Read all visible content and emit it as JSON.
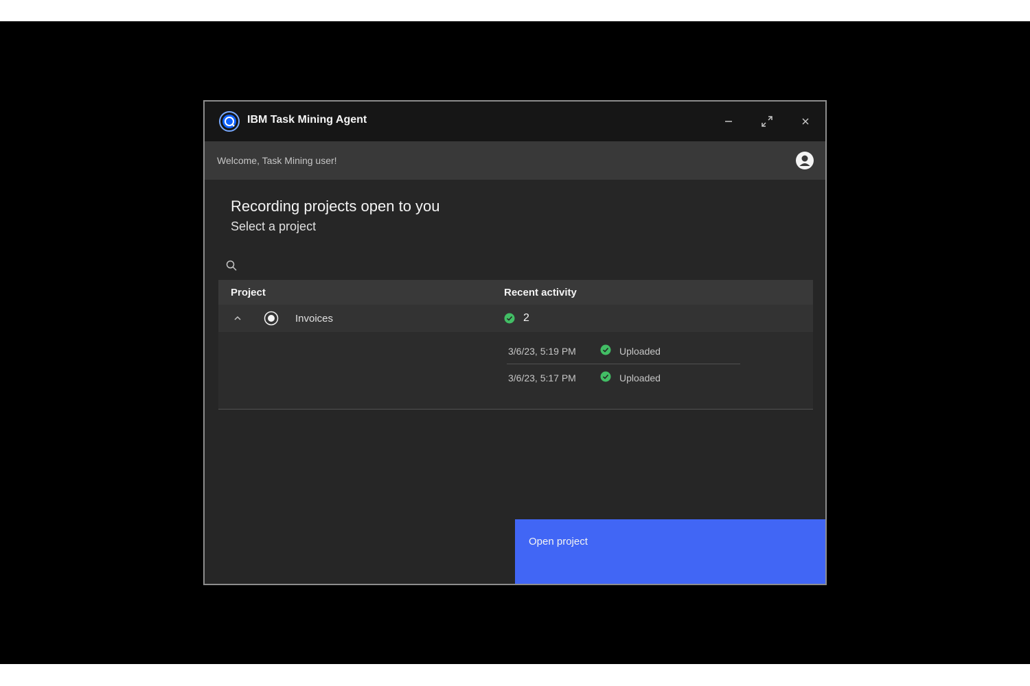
{
  "window": {
    "title": "IBM Task Mining Agent",
    "controls": {
      "minimize_icon": "minus-icon",
      "maximize_icon": "maximize-icon",
      "close_icon": "close-icon"
    }
  },
  "header": {
    "welcome": "Welcome, Task Mining user!",
    "avatar_icon": "user-avatar-icon"
  },
  "main": {
    "title": "Recording projects open to you",
    "subtitle": "Select a project",
    "search": {
      "placeholder": "",
      "value": ""
    },
    "table": {
      "columns": [
        "Project",
        "Recent activity"
      ],
      "rows": [
        {
          "name": "Invoices",
          "selected": true,
          "expanded": true,
          "activity_count": "2",
          "activities": [
            {
              "time": "3/6/23, 5:19 PM",
              "status": "Uploaded"
            },
            {
              "time": "3/6/23, 5:17 PM",
              "status": "Uploaded"
            }
          ]
        }
      ]
    }
  },
  "footer": {
    "open_button": "Open project"
  },
  "colors": {
    "accent": "#4166f5",
    "success": "#42be65",
    "surface": "#262626",
    "titlebar": "#161616"
  }
}
